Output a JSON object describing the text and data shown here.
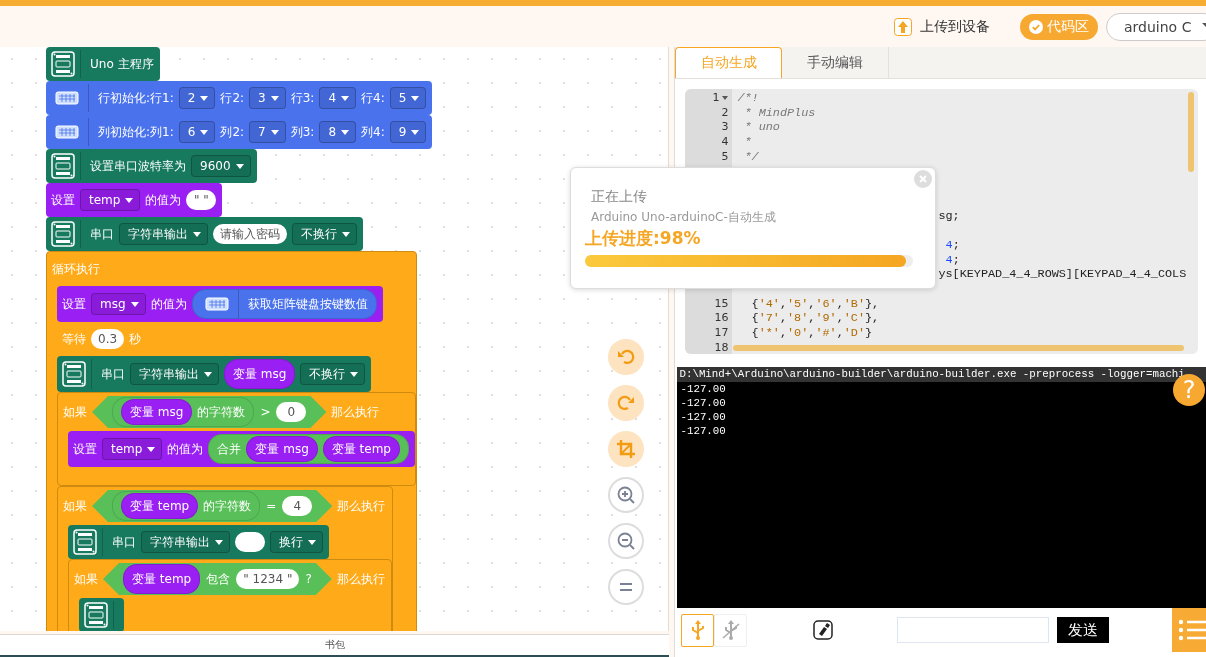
{
  "header": {
    "upload_button": "上传到设备",
    "code_area_button": "代码区",
    "board_selector": "arduino C"
  },
  "blocks": [
    {
      "kind": "board",
      "color": "#177a5f",
      "parts": [
        {
          "kind": "text",
          "text": "Uno 主程序"
        }
      ]
    },
    {
      "kind": "keypad",
      "color": "#4a72ec",
      "parts": [
        {
          "kind": "text",
          "text": "行初始化:行1:"
        },
        {
          "kind": "dropdown",
          "text": "2"
        },
        {
          "kind": "text",
          "text": "行2:"
        },
        {
          "kind": "dropdown",
          "text": "3"
        },
        {
          "kind": "text",
          "text": "行3:"
        },
        {
          "kind": "dropdown",
          "text": "4"
        },
        {
          "kind": "text",
          "text": "行4:"
        },
        {
          "kind": "dropdown",
          "text": "5"
        }
      ]
    },
    {
      "kind": "keypad",
      "color": "#4a72ec",
      "parts": [
        {
          "kind": "text",
          "text": "列初始化:列1:"
        },
        {
          "kind": "dropdown",
          "text": "6"
        },
        {
          "kind": "text",
          "text": "列2:"
        },
        {
          "kind": "dropdown",
          "text": "7"
        },
        {
          "kind": "text",
          "text": "列3:"
        },
        {
          "kind": "dropdown",
          "text": "8"
        },
        {
          "kind": "text",
          "text": "列4:"
        },
        {
          "kind": "dropdown",
          "text": "9"
        }
      ]
    },
    {
      "kind": "board",
      "color": "#177a5f",
      "parts": [
        {
          "kind": "text",
          "text": "设置串口波特率为"
        },
        {
          "kind": "dropdown",
          "text": "9600"
        }
      ]
    },
    {
      "kind": "plain",
      "color": "#9a1ff2",
      "parts": [
        {
          "kind": "text",
          "text": "设置"
        },
        {
          "kind": "dropdown",
          "text": "temp"
        },
        {
          "kind": "text",
          "text": "的值为"
        },
        {
          "kind": "input",
          "text": "\" \""
        }
      ]
    },
    {
      "kind": "board",
      "color": "#177a5f",
      "parts": [
        {
          "kind": "text",
          "text": "串口"
        },
        {
          "kind": "dropdown",
          "text": "字符串输出"
        },
        {
          "kind": "input",
          "text": "请输入密码"
        },
        {
          "kind": "dropdown",
          "text": "不换行"
        }
      ]
    },
    {
      "kind": "plain",
      "color": "#ffab19",
      "parts": [
        {
          "kind": "text",
          "text": "循环执行"
        }
      ],
      "children": [
        {
          "kind": "plain",
          "color": "#9a1ff2",
          "parts": [
            {
              "kind": "text",
              "text": "设置"
            },
            {
              "kind": "dropdown",
              "text": "msg"
            },
            {
              "kind": "text",
              "text": "的值为"
            },
            {
              "kind": "keypad_reporter",
              "color": "#4a72ec",
              "parts": [
                {
                  "kind": "text",
                  "text": "获取矩阵键盘按键数值"
                }
              ]
            }
          ]
        },
        {
          "kind": "plain",
          "color": "#ffab19",
          "parts": [
            {
              "kind": "text",
              "text": "等待"
            },
            {
              "kind": "input",
              "text": "0.3"
            },
            {
              "kind": "text",
              "text": "秒"
            }
          ]
        },
        {
          "kind": "board",
          "color": "#177a5f",
          "parts": [
            {
              "kind": "text",
              "text": "串口"
            },
            {
              "kind": "dropdown",
              "text": "字符串输出"
            },
            {
              "kind": "reporter",
              "color": "#9a1ff2",
              "parts": [
                {
                  "kind": "text",
                  "text": "变量 msg"
                }
              ]
            },
            {
              "kind": "dropdown",
              "text": "不换行"
            }
          ]
        },
        {
          "kind": "plain",
          "color": "#ffab19",
          "parts": [
            {
              "kind": "text",
              "text": "如果"
            },
            {
              "kind": "condition",
              "color": "#59c059",
              "parts": [
                {
                  "kind": "reporter",
                  "color": "#59c059",
                  "parts": [
                    {
                      "kind": "reporter",
                      "color": "#9a1ff2",
                      "parts": [
                        {
                          "kind": "text",
                          "text": "变量 msg"
                        }
                      ]
                    },
                    {
                      "kind": "text",
                      "text": "的字符数"
                    }
                  ]
                },
                {
                  "kind": "text",
                  "text": ">"
                },
                {
                  "kind": "input",
                  "text": "0"
                }
              ]
            },
            {
              "kind": "text",
              "text": "那么执行"
            }
          ],
          "children": [
            {
              "kind": "plain",
              "color": "#9a1ff2",
              "parts": [
                {
                  "kind": "text",
                  "text": "设置"
                },
                {
                  "kind": "dropdown",
                  "text": "temp"
                },
                {
                  "kind": "text",
                  "text": "的值为"
                },
                {
                  "kind": "reporter",
                  "color": "#59c059",
                  "parts": [
                    {
                      "kind": "text",
                      "text": "合并"
                    },
                    {
                      "kind": "reporter",
                      "color": "#9a1ff2",
                      "parts": [
                        {
                          "kind": "text",
                          "text": "变量 msg"
                        }
                      ]
                    },
                    {
                      "kind": "reporter",
                      "color": "#9a1ff2",
                      "parts": [
                        {
                          "kind": "text",
                          "text": "变量 temp"
                        }
                      ]
                    }
                  ]
                }
              ]
            }
          ]
        },
        {
          "kind": "plain",
          "color": "#ffab19",
          "parts": [
            {
              "kind": "text",
              "text": "如果"
            },
            {
              "kind": "condition",
              "color": "#59c059",
              "parts": [
                {
                  "kind": "reporter",
                  "color": "#59c059",
                  "parts": [
                    {
                      "kind": "reporter",
                      "color": "#9a1ff2",
                      "parts": [
                        {
                          "kind": "text",
                          "text": "变量 temp"
                        }
                      ]
                    },
                    {
                      "kind": "text",
                      "text": "的字符数"
                    }
                  ]
                },
                {
                  "kind": "text",
                  "text": "="
                },
                {
                  "kind": "input",
                  "text": "4"
                }
              ]
            },
            {
              "kind": "text",
              "text": "那么执行"
            }
          ],
          "children": [
            {
              "kind": "board",
              "color": "#177a5f",
              "parts": [
                {
                  "kind": "text",
                  "text": "串口"
                },
                {
                  "kind": "dropdown",
                  "text": "字符串输出"
                },
                {
                  "kind": "input"
                },
                {
                  "kind": "dropdown",
                  "text": "换行"
                }
              ]
            },
            {
              "kind": "plain",
              "color": "#ffab19",
              "parts": [
                {
                  "kind": "text",
                  "text": "如果"
                },
                {
                  "kind": "condition",
                  "color": "#59c059",
                  "parts": [
                    {
                      "kind": "reporter",
                      "color": "#9a1ff2",
                      "parts": [
                        {
                          "kind": "text",
                          "text": "变量 temp"
                        }
                      ]
                    },
                    {
                      "kind": "text",
                      "text": "包含"
                    },
                    {
                      "kind": "input",
                      "text": "\" 1234 \""
                    },
                    {
                      "kind": "text",
                      "text": "?"
                    }
                  ]
                },
                {
                  "kind": "text",
                  "text": "那么执行"
                }
              ],
              "children": [
                {
                  "kind": "board",
                  "color": "#177a5f"
                }
              ]
            }
          ]
        }
      ]
    }
  ],
  "bag_bar": "书包",
  "tabs": [
    {
      "label": "自动生成",
      "selected": true
    },
    {
      "label": "手动编辑",
      "selected": false
    }
  ],
  "code_lines": [
    {
      "kind": "comment",
      "number": "1",
      "text": "/*!"
    },
    {
      "kind": "comment",
      "number": "2",
      "text": " * MindPlus"
    },
    {
      "kind": "comment",
      "number": "3",
      "text": " * uno"
    },
    {
      "kind": "comment",
      "number": "4",
      "text": " *"
    },
    {
      "kind": "comment",
      "number": "5",
      "text": " */"
    },
    {
      "kind": "covered"
    },
    {
      "kind": "covered"
    },
    {
      "kind": "covered"
    },
    {
      "kind": "tail",
      "text": "sg;"
    },
    {
      "kind": "covered"
    },
    {
      "kind": "tail",
      "text": " 4;"
    },
    {
      "kind": "tail",
      "text": " 4;"
    },
    {
      "kind": "tail",
      "text": "ys[KEYPAD_4_4_ROWS][KEYPAD_4_4_COLS"
    },
    {
      "kind": "covered"
    },
    {
      "kind": "code",
      "number": "15",
      "text": "  {'4','5','6','B'},"
    },
    {
      "kind": "code",
      "number": "16",
      "text": "  {'7','8','9','C'},"
    },
    {
      "kind": "code",
      "number": "17",
      "text": "  {'*','0','#','D'}"
    },
    {
      "kind": "code",
      "number": "18"
    }
  ],
  "upload_popup": {
    "title": "正在上传",
    "subtitle": "Arduino Uno-arduinoC-自动生成",
    "progress_text": "上传进度:98%",
    "level": 0.98
  },
  "console": {
    "command": "D:\\Mind+\\Arduino\\arduino-builder\\arduino-builder.exe -preprocess -logger=machi",
    "lines": [
      "-127.00",
      "-127.00",
      "-127.00",
      "-127.00"
    ]
  },
  "help_button": "?",
  "connection_buttons": [
    {
      "kind": "usb",
      "selected": true
    },
    {
      "kind": "usb_off",
      "selected": false
    }
  ],
  "send_button": "发送"
}
